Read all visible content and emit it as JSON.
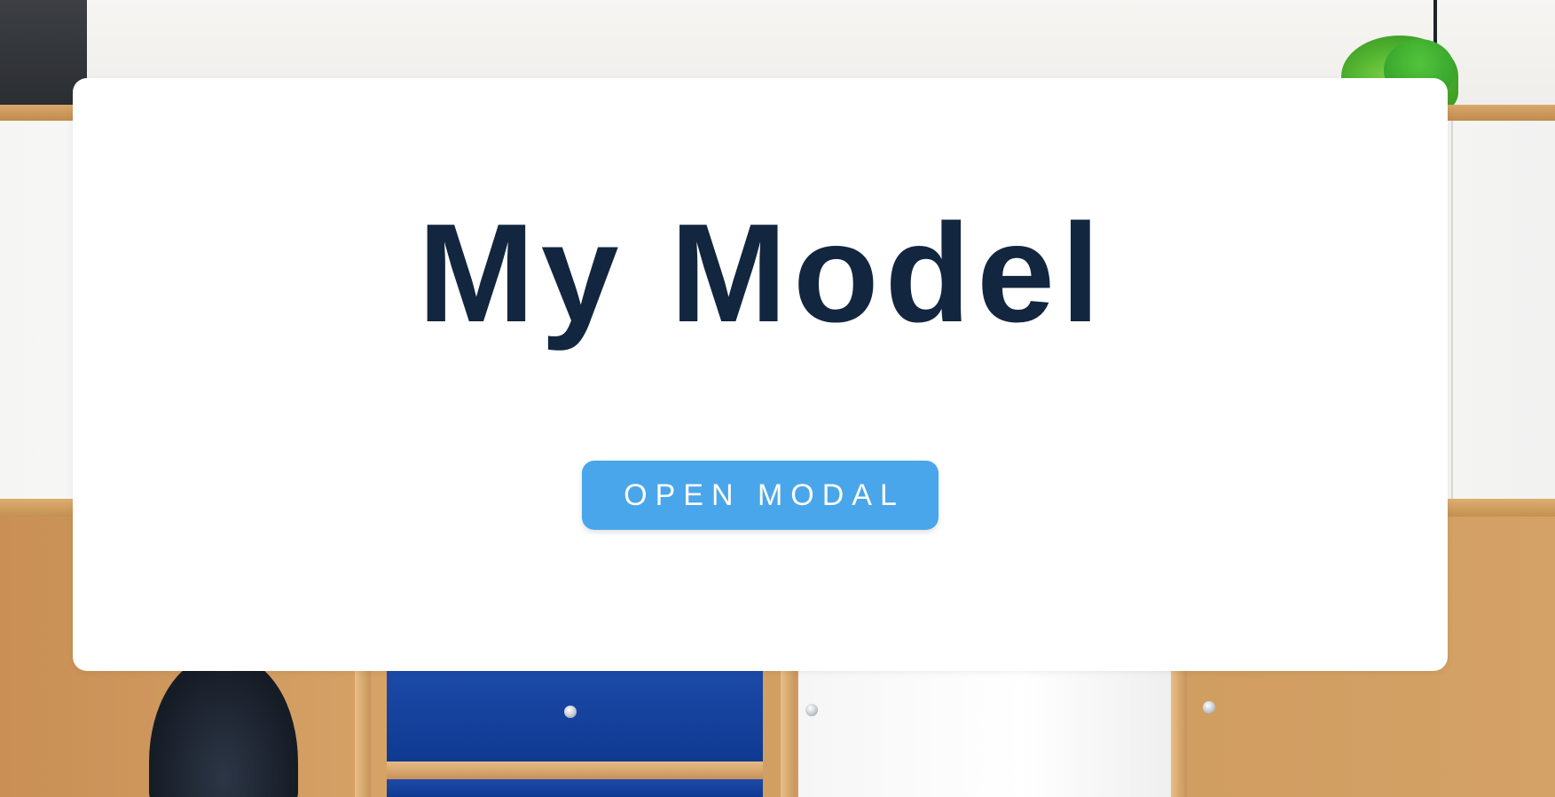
{
  "page": {
    "title": "My Model"
  },
  "actions": {
    "open_modal_label": "Open Modal"
  },
  "colors": {
    "title": "#13263f",
    "button_bg": "#4aa6ea",
    "button_text": "#ffffff",
    "card_bg": "#ffffff"
  },
  "icons": {
    "background": "furniture-photo"
  }
}
